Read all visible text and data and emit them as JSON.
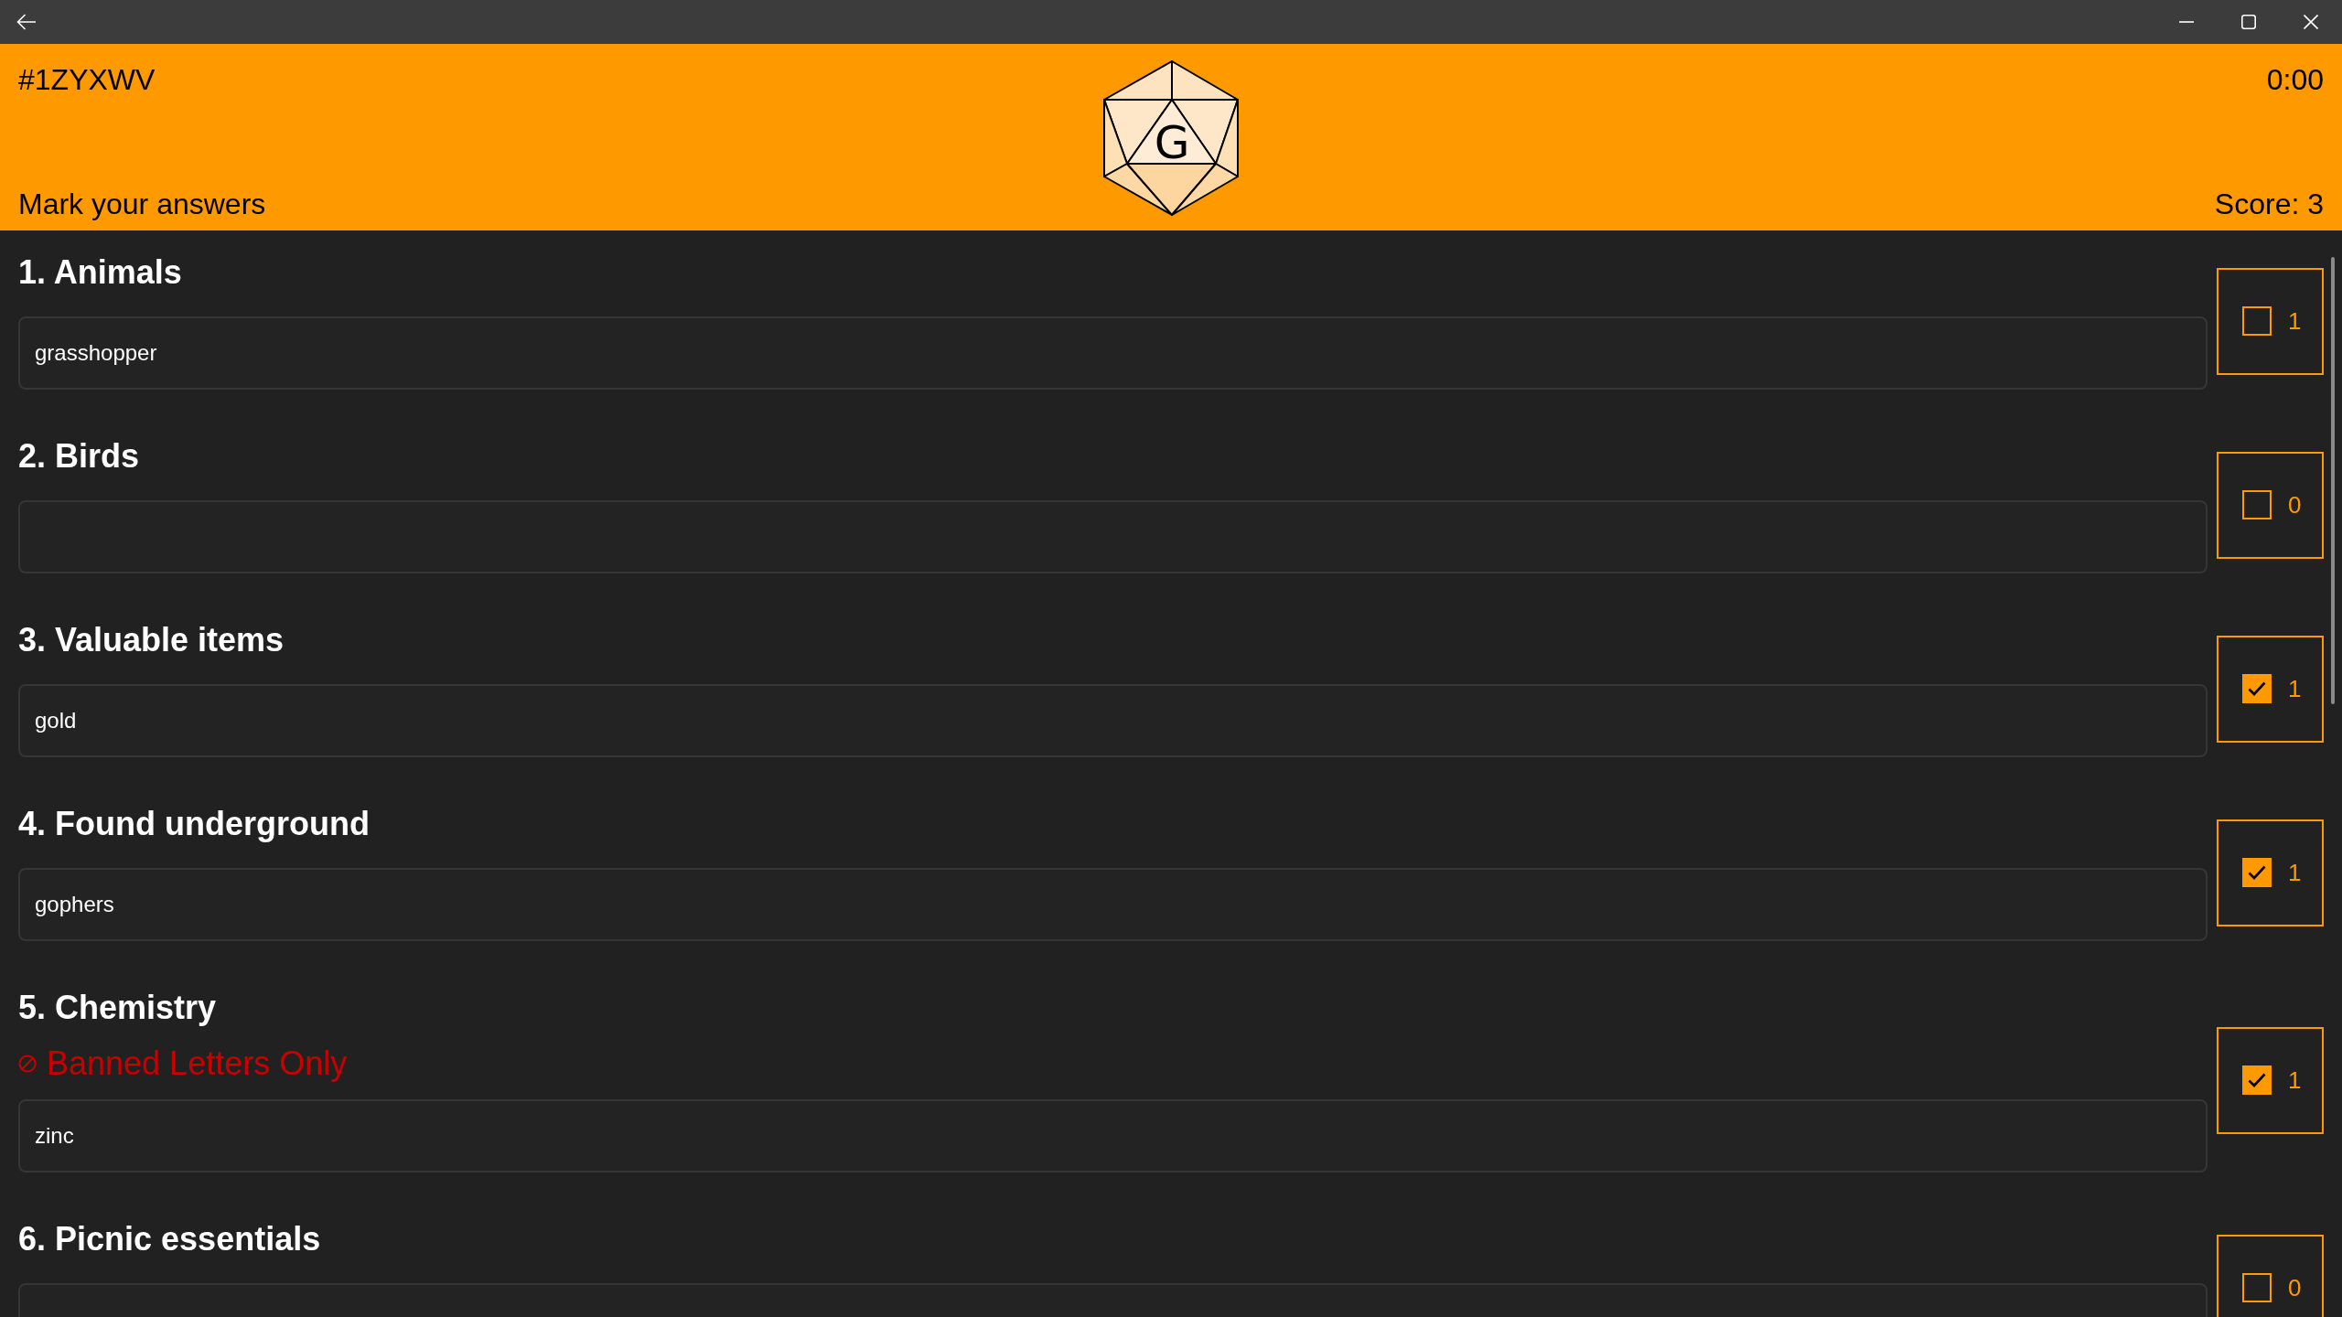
{
  "header": {
    "game_code": "#1ZYXWV",
    "timer": "0:00",
    "logo": {
      "letter": "G"
    },
    "instruction": "Mark your answers",
    "score": "Score: 3"
  },
  "questions": [
    {
      "title": "1. Animals",
      "answer": "grasshopper",
      "checked": false,
      "points": "1"
    },
    {
      "title": "2. Birds",
      "checked": false,
      "points": "0"
    },
    {
      "title": "3. Valuable items",
      "answer": "gold",
      "checked": true,
      "points": "1"
    },
    {
      "title": "4. Found underground",
      "answer": "gophers",
      "checked": true,
      "points": "1"
    },
    {
      "title": "5. Chemistry",
      "rule": "Banned Letters Only",
      "answer": "zinc",
      "checked": true,
      "points": "1"
    },
    {
      "title": "6. Picnic essentials",
      "checked": false,
      "points": "0"
    }
  ]
}
